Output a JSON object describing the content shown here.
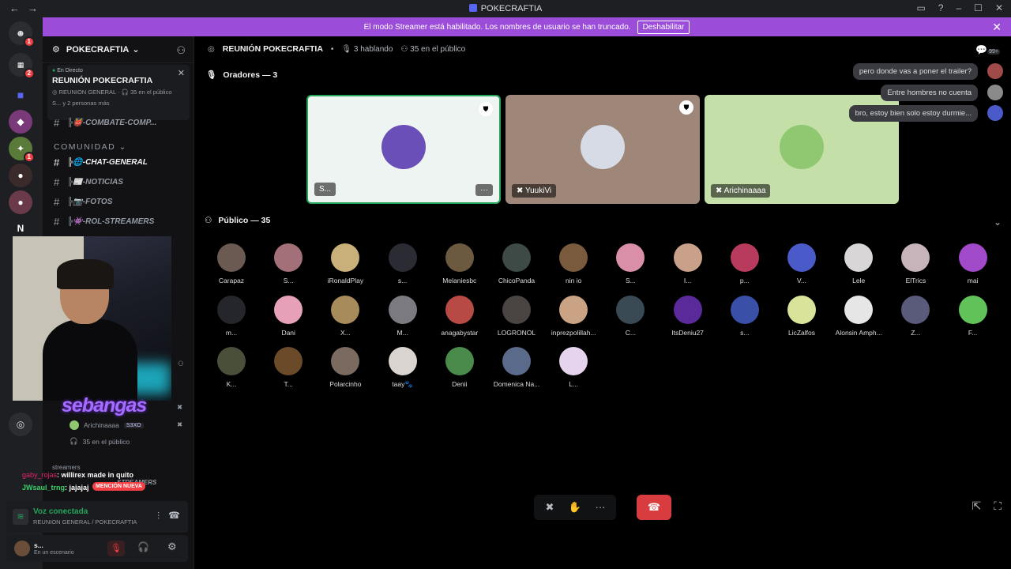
{
  "window": {
    "title": "POKECRAFTIA"
  },
  "banner": {
    "text": "El modo Streamer está habilitado. Los nombres de usuario se han truncado.",
    "button_label": "Deshabilitar"
  },
  "rail": {
    "badges": [
      "1",
      "2",
      "1",
      "1"
    ],
    "letter_server": "N"
  },
  "sidebar": {
    "server_name": "POKECRAFTIA",
    "live_card": {
      "status": "En Directo",
      "stage_name": "REUNIÓN POKECRAFTIA",
      "subtitle_channel": "REUNION GENERAL",
      "subtitle_audience": "35 en el público",
      "people": "S... y 2 personas más"
    },
    "partial_channel": "╠👹-COMBATE-COMP...",
    "category": "COMUNIDAD",
    "channels": [
      {
        "label": "╠🌐-CHAT-GENERAL",
        "active": true
      },
      {
        "label": "╠📰-NOTICIAS",
        "active": false
      },
      {
        "label": "╠📷-FOTOS",
        "active": false
      },
      {
        "label": "╠👾-ROL-STREAMERS",
        "active": false
      }
    ],
    "stage_users": [
      {
        "name": "Arichinaaaa",
        "tag": "S3XO"
      }
    ],
    "audience_row": "35 en el público",
    "streamers_cat": "streamers",
    "streamers_partial": "STREAMERS"
  },
  "cam_overlay": {
    "brand": "sebangas"
  },
  "chat_overlay": {
    "messages": [
      {
        "user": "gaby_rojas",
        "text": ": willirex made in quito"
      },
      {
        "user": "JWsaul_trng",
        "text": ": jajajaj"
      }
    ],
    "mention_badge": "MENCIÓN NUEVA"
  },
  "voice": {
    "status": "Voz conectada",
    "location": "REUNION GENERAL / POKECRAFTIA"
  },
  "user_panel": {
    "name": "s...",
    "status": "En un escenario"
  },
  "stage": {
    "title": "REUNIÓN POKECRAFTIA",
    "speaking": "3 hablando",
    "audience": "35 en el público",
    "speakers_title": "Oradores — 3",
    "speakers": [
      {
        "name": "S...",
        "bg": "#eef4f1",
        "avatar_color": "#6b4fb8"
      },
      {
        "name": "YuukiVi",
        "bg": "#9e8779",
        "avatar_color": "#d7dbe6"
      },
      {
        "name": "Arichinaaaa",
        "bg": "#c5dfa8",
        "avatar_color": "#8fc870"
      }
    ],
    "audience_title": "Público — 35",
    "audience_members": [
      {
        "name": "Carapaz",
        "color": "#6b5a52"
      },
      {
        "name": "S...",
        "color": "#a3707a"
      },
      {
        "name": "iRonaldPlay",
        "color": "#c9b07a"
      },
      {
        "name": "s...",
        "color": "#2b2c33"
      },
      {
        "name": "Melaniesbc",
        "color": "#6b5a3f"
      },
      {
        "name": "ChicoPanda",
        "color": "#3d4a45"
      },
      {
        "name": "nin io",
        "color": "#7a5a3c"
      },
      {
        "name": "S...",
        "color": "#d98fa8"
      },
      {
        "name": "I...",
        "color": "#c9a08a"
      },
      {
        "name": "p...",
        "color": "#b83a5c"
      },
      {
        "name": "V...",
        "color": "#4a5ac9"
      },
      {
        "name": "Lele",
        "color": "#d8d6d6"
      },
      {
        "name": "ElTrics",
        "color": "#c7b4bb"
      },
      {
        "name": "mai",
        "color": "#a04ac9"
      },
      {
        "name": "m...",
        "color": "#25262b"
      },
      {
        "name": "Dani",
        "color": "#e6a0b8"
      },
      {
        "name": "X...",
        "color": "#a88b5a"
      },
      {
        "name": "M...",
        "color": "#7a7a80"
      },
      {
        "name": "anagabystar",
        "color": "#b84a45"
      },
      {
        "name": "LOGRONOL",
        "color": "#4a4442"
      },
      {
        "name": "inprezpolillah...",
        "color": "#c9a383"
      },
      {
        "name": "C...",
        "color": "#3a4a54"
      },
      {
        "name": "ItsDeniu27",
        "color": "#5a2a9a"
      },
      {
        "name": "s...",
        "color": "#3a4fa8"
      },
      {
        "name": "LicZalfos",
        "color": "#d9e39a"
      },
      {
        "name": "Alonsin Amph...",
        "color": "#e6e6e6"
      },
      {
        "name": "Z...",
        "color": "#5a5a7a"
      },
      {
        "name": "F...",
        "color": "#62c25a"
      },
      {
        "name": "K...",
        "color": "#4a4f3a"
      },
      {
        "name": "T...",
        "color": "#6b4a2a"
      },
      {
        "name": "Polarcinho",
        "color": "#7a6a60"
      },
      {
        "name": "taay🐾",
        "color": "#d9d4cf"
      },
      {
        "name": "Denii",
        "color": "#4a8a4a"
      },
      {
        "name": "Domenica Na...",
        "color": "#5a6a8a"
      },
      {
        "name": "L...",
        "color": "#e6d4ef"
      }
    ]
  },
  "bubbles": [
    {
      "text": "pero donde vas a poner el trailer?",
      "color": "#a04a4a"
    },
    {
      "text": "Entre hombres no cuenta",
      "color": "#8a8a8a"
    },
    {
      "text": "bro, estoy bien solo estoy durmie...",
      "color": "#4a5ac9"
    }
  ],
  "notification_count": "99+",
  "colors": {
    "banner": "#9b4dd9",
    "live": "#23a55a",
    "danger": "#d83c3e",
    "blurple": "#5865f2"
  }
}
